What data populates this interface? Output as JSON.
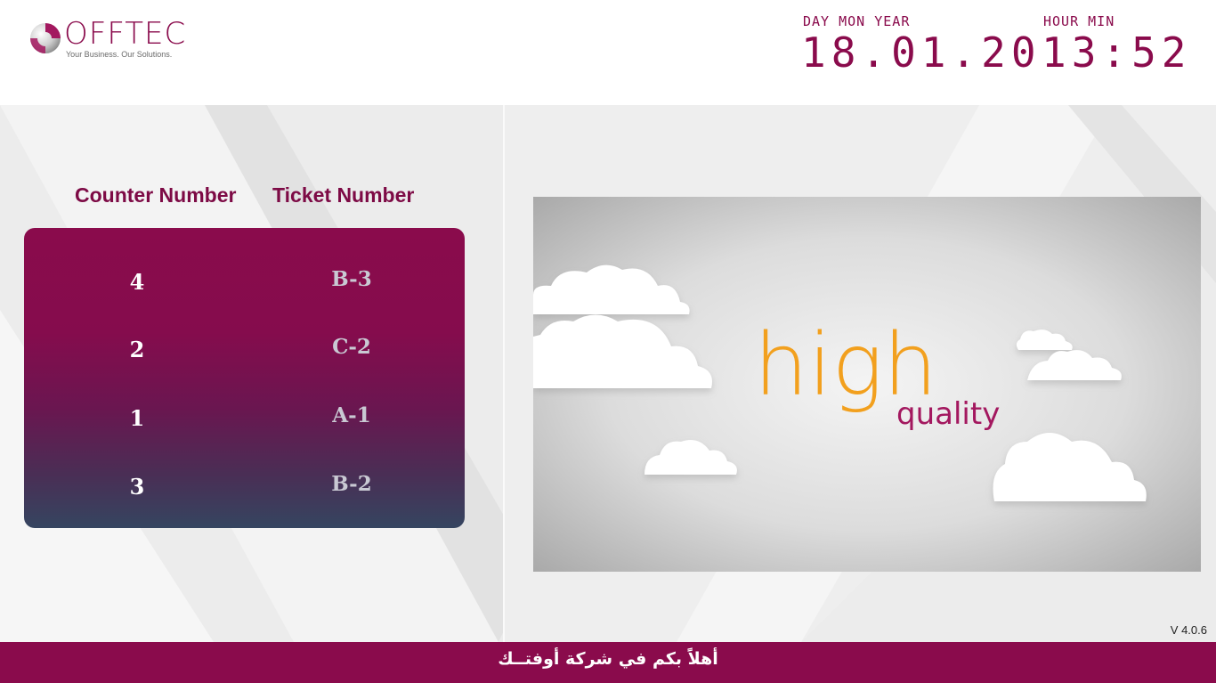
{
  "brand": {
    "name": "OFFTEC",
    "tagline": "Your Business. Our Solutions.",
    "accent_color": "#8a0b4c"
  },
  "clock": {
    "date_label": "DAY MON YEAR",
    "date_value": "18.01.20",
    "time_label": "HOUR MIN",
    "time_value": "13:52"
  },
  "queue": {
    "headers": {
      "counter": "Counter Number",
      "ticket": "Ticket Number"
    },
    "rows": [
      {
        "counter": "4",
        "ticket": "B-3"
      },
      {
        "counter": "2",
        "ticket": "C-2"
      },
      {
        "counter": "1",
        "ticket": "A-1"
      },
      {
        "counter": "3",
        "ticket": "B-2"
      }
    ]
  },
  "media": {
    "headline": "high",
    "subline": "quality",
    "headline_color": "#f2a01e",
    "subline_color": "#a3185f"
  },
  "version": "V 4.0.6",
  "footer": {
    "message": "أهلاً بكم في شركة أوفتــك"
  }
}
